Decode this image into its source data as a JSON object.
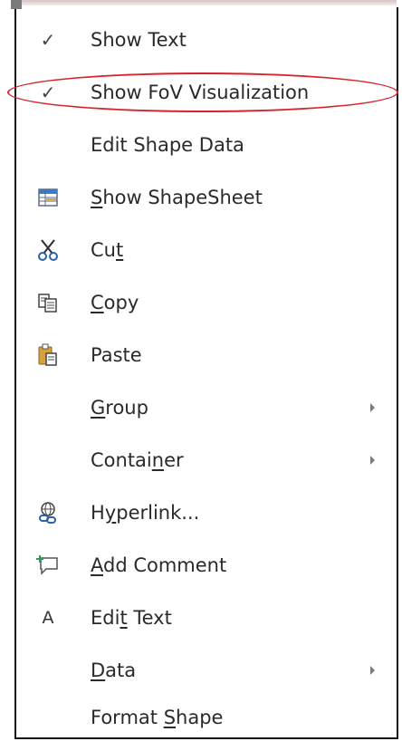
{
  "menu": {
    "items": [
      {
        "label": "Show Text",
        "icon": "check-icon",
        "submenu": false
      },
      {
        "label": "Show FoV Visualization",
        "icon": "check-icon",
        "submenu": false
      },
      {
        "label": "Edit Shape Data",
        "icon": "",
        "submenu": false
      },
      {
        "label": "Show ShapeSheet",
        "icon": "shapesheet-icon",
        "submenu": false,
        "accelerator": "S"
      },
      {
        "label": "Cut",
        "icon": "scissors-icon",
        "submenu": false,
        "accelerator": "t"
      },
      {
        "label": "Copy",
        "icon": "copy-icon",
        "submenu": false,
        "accelerator": "C"
      },
      {
        "label": "Paste",
        "icon": "paste-icon",
        "submenu": false
      },
      {
        "label": "Group",
        "icon": "",
        "submenu": true,
        "accelerator": "G"
      },
      {
        "label": "Container",
        "icon": "",
        "submenu": true,
        "accelerator": "n"
      },
      {
        "label": "Hyperlink...",
        "icon": "hyperlink-icon",
        "submenu": false,
        "accelerator": "y"
      },
      {
        "label": "Add Comment",
        "icon": "comment-icon",
        "submenu": false,
        "accelerator": "A"
      },
      {
        "label": "Edit Text",
        "icon": "text-icon",
        "submenu": false,
        "accelerator": "t"
      },
      {
        "label": "Data",
        "icon": "",
        "submenu": true,
        "accelerator": "D"
      },
      {
        "label": "Format Shape",
        "icon": "",
        "submenu": false,
        "accelerator": "S"
      }
    ]
  },
  "annotation": {
    "highlight_color": "#d7232b",
    "highlighted_item": "Show FoV Visualization"
  },
  "icons": {
    "check": "✓",
    "text": "A"
  }
}
